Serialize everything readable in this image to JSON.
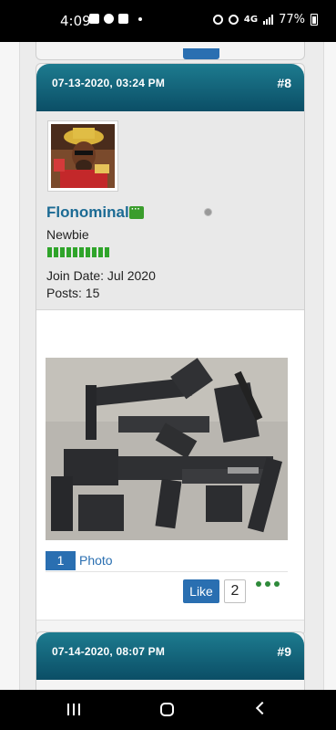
{
  "status_bar": {
    "time": "4:09",
    "network": "4G",
    "battery": "77%"
  },
  "posts": [
    {
      "date": "07-13-2020, 03:24 PM",
      "number": "#8",
      "username": "Flonominal",
      "user_title": "Newbie",
      "join_date": "Join Date: Jul 2020",
      "posts_count": "Posts: 15",
      "attachment_count": "1",
      "attachment_label": "Photo",
      "like_label": "Like",
      "like_count": "2"
    },
    {
      "date": "07-14-2020, 08:07 PM",
      "number": "#9"
    }
  ],
  "colors": {
    "header": "#0b4e66",
    "username": "#1c6b94",
    "link": "#2a6fb1",
    "reputation": "#2fa42a"
  },
  "icons": {
    "message": "message-icon",
    "online_status": "online-status-icon",
    "more": "more-options-icon",
    "nav_recents": "recent-apps-icon",
    "nav_home": "home-icon",
    "nav_back": "back-icon"
  }
}
